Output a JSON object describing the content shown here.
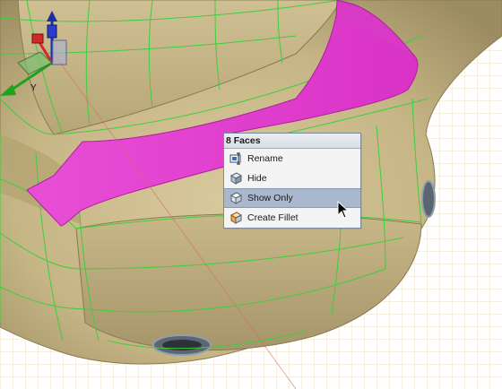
{
  "context_menu": {
    "header": "8 Faces",
    "items": [
      {
        "label": "Rename",
        "icon": "rename-icon",
        "selected": false
      },
      {
        "label": "Hide",
        "icon": "hide-icon",
        "selected": false
      },
      {
        "label": "Show Only",
        "icon": "show-only-icon",
        "selected": true
      },
      {
        "label": "Create Fillet",
        "icon": "create-fillet-icon",
        "selected": false
      }
    ]
  },
  "viewport": {
    "model": "car rear body surface",
    "selection_color": "#e040cc",
    "body_color": "#c9b98c",
    "edge_color": "#3cd23c",
    "grid_color": "#e6d9b5"
  },
  "gizmo": {
    "axes": [
      "x-axis",
      "y-axis",
      "z-axis"
    ],
    "x_color": "#d12a2a",
    "y_color": "#1fa31f",
    "z_color": "#1d2fa8"
  }
}
